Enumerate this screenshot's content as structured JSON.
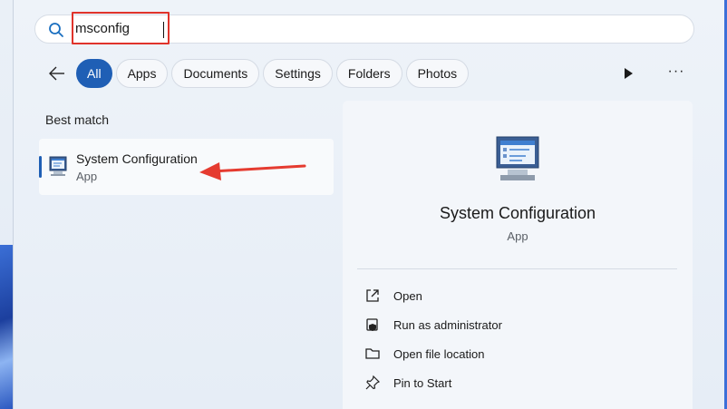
{
  "search": {
    "value": "msconfig",
    "icon": "search-icon"
  },
  "filters": [
    {
      "label": "All",
      "active": true
    },
    {
      "label": "Apps",
      "active": false
    },
    {
      "label": "Documents",
      "active": false
    },
    {
      "label": "Settings",
      "active": false
    },
    {
      "label": "Folders",
      "active": false
    },
    {
      "label": "Photos",
      "active": false
    }
  ],
  "toolbar": {
    "back_icon": "back-arrow-icon",
    "play_icon": "play-icon",
    "more_label": "···"
  },
  "results": {
    "section_label": "Best match",
    "best_match": {
      "title": "System Configuration",
      "subtitle": "App",
      "icon": "system-configuration-icon"
    }
  },
  "detail": {
    "title": "System Configuration",
    "subtitle": "App",
    "actions": [
      {
        "label": "Open",
        "icon": "open-external-icon"
      },
      {
        "label": "Run as administrator",
        "icon": "shield-icon"
      },
      {
        "label": "Open file location",
        "icon": "folder-icon"
      },
      {
        "label": "Pin to Start",
        "icon": "pin-icon"
      }
    ]
  },
  "colors": {
    "accent": "#1f5fb5",
    "highlight_box": "#e0332b",
    "annotation_arrow": "#e53b30"
  }
}
